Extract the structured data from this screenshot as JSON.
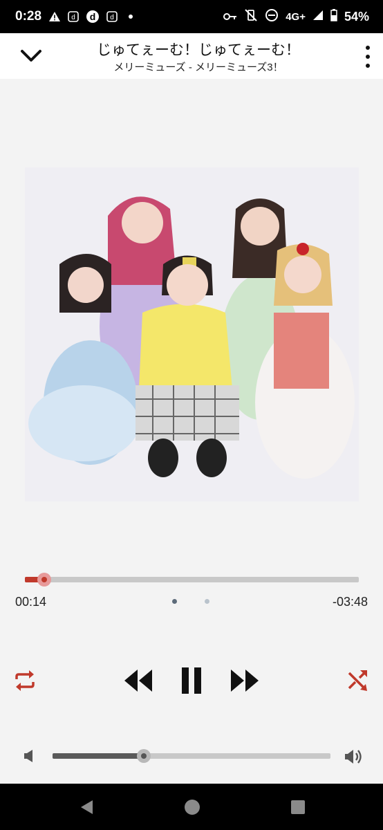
{
  "status_bar": {
    "time": "0:28",
    "network": "4G+",
    "battery": "54%",
    "left_icons": [
      "alert-icon",
      "d-app-icon",
      "d-app-round-icon",
      "d-app-icon",
      "dot-icon"
    ],
    "right_icons": [
      "vpn-key-icon",
      "vibrate-off-icon",
      "do-not-disturb-icon",
      "signal-icon",
      "battery-icon"
    ]
  },
  "header": {
    "title": "じゅてぇーむ！じゅてぇーむ！",
    "subtitle": "メリーミューズ - メリーミューズ3！"
  },
  "album_art": {
    "description_icon": "album-art-photo",
    "background": "#efeef3"
  },
  "playback": {
    "elapsed": "00:14",
    "remaining": "-03:48",
    "progress_fraction": 0.057,
    "page_indicator": {
      "count": 2,
      "active": 0
    }
  },
  "volume": {
    "level_fraction": 0.328
  },
  "colors": {
    "accent": "#c0392b",
    "primary_icon": "#111111",
    "dot_active": "#5d6b7a",
    "dot_inactive": "#b9c3cc"
  },
  "nav_bar": {
    "icons": [
      "back-icon",
      "home-icon",
      "recents-icon"
    ]
  }
}
